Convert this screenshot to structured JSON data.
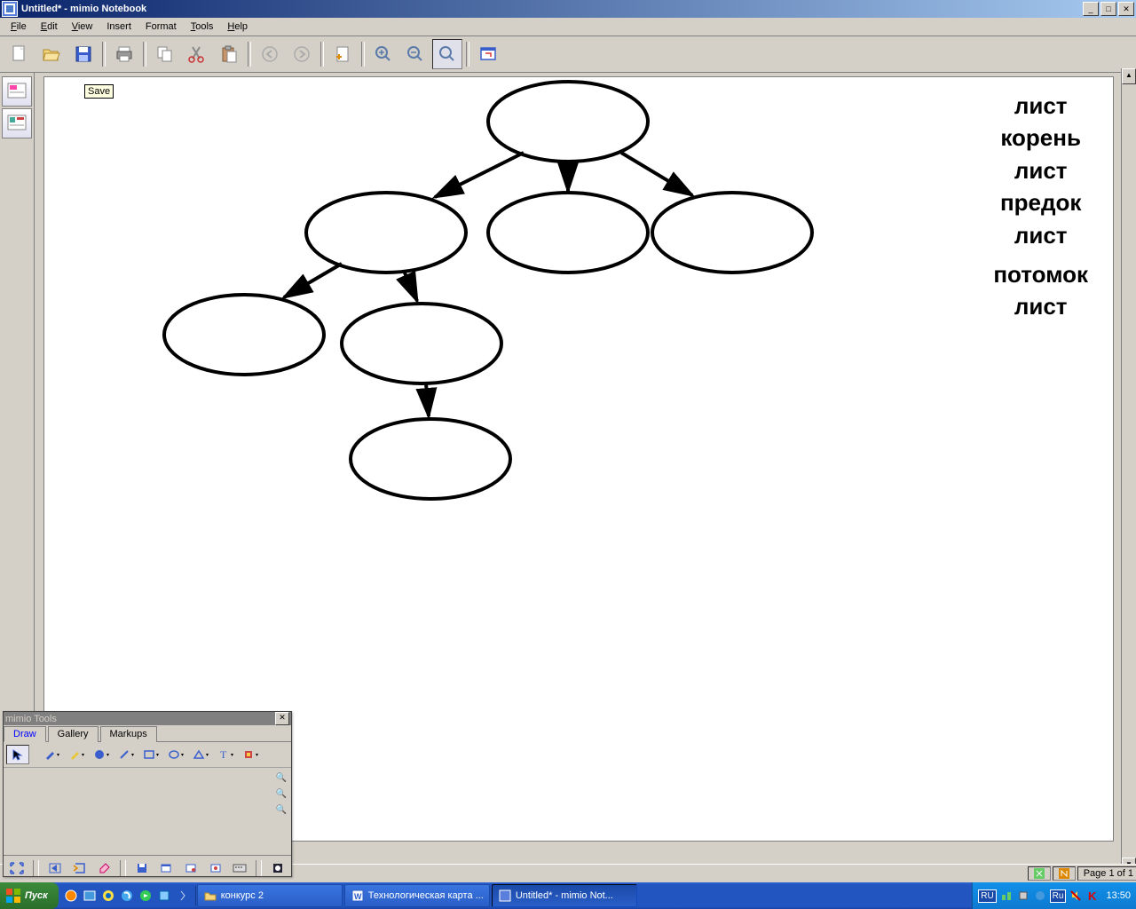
{
  "window": {
    "title": "Untitled* - mimio Notebook"
  },
  "menu": {
    "file": "File",
    "edit": "Edit",
    "view": "View",
    "insert": "Insert",
    "format": "Format",
    "tools": "Tools",
    "help": "Help"
  },
  "tooltip": {
    "save": "Save"
  },
  "toolspanel": {
    "title": "mimio Tools",
    "tab_draw": "Draw",
    "tab_gallery": "Gallery",
    "tab_markups": "Markups"
  },
  "status": {
    "page": "Page 1 of 1"
  },
  "taskbar": {
    "start": "Пуск",
    "items": [
      {
        "label": "конкурс 2",
        "icon": "folder"
      },
      {
        "label": "Технологическая карта ...",
        "icon": "word"
      },
      {
        "label": "Untitled* - mimio Not...",
        "icon": "mimio",
        "active": true
      }
    ],
    "lang1": "RU",
    "lang2": "Ru",
    "clock": "13:50"
  },
  "words": [
    "лист",
    "корень",
    "лист",
    "предок",
    "лист",
    "потомок",
    "лист"
  ]
}
